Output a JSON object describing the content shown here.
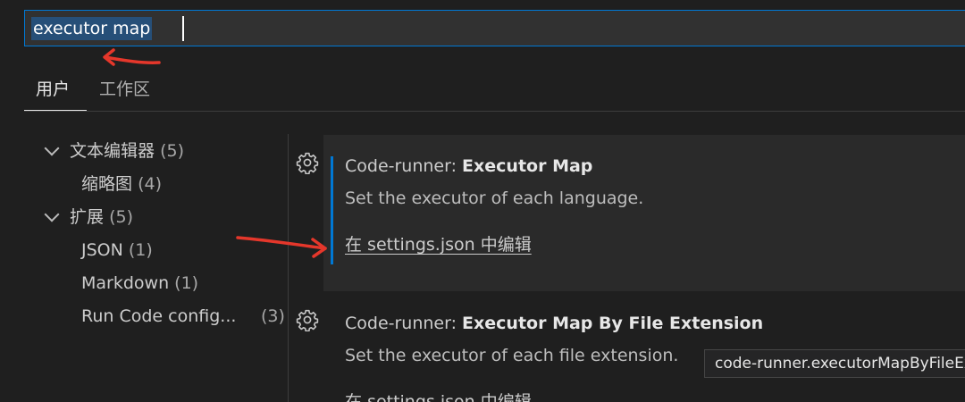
{
  "search": {
    "query": "executor map"
  },
  "tabs": [
    {
      "label": "用户"
    },
    {
      "label": "工作区"
    }
  ],
  "tree": {
    "text_editor": {
      "label": "文本编辑器",
      "count": "(5)"
    },
    "minimap": {
      "label": "缩略图",
      "count": "(4)"
    },
    "extensions": {
      "label": "扩展",
      "count": "(5)"
    },
    "json": {
      "label": "JSON",
      "count": "(1)"
    },
    "markdown": {
      "label": "Markdown",
      "count": "(1)"
    },
    "run_code": {
      "label": "Run Code config...",
      "count": "(3)"
    }
  },
  "settings": [
    {
      "category": "Code-runner: ",
      "name": "Executor Map",
      "description": "Set the executor of each language.",
      "edit_link": "在 settings.json 中编辑"
    },
    {
      "category": "Code-runner: ",
      "name": "Executor Map By File Extension",
      "description": "Set the executor of each file extension.",
      "edit_link": "在 settings.json 中编辑"
    }
  ],
  "tooltip": {
    "text": "code-runner.executorMapByFileExtension"
  },
  "colors": {
    "background": "#1f1f1f",
    "focus_border": "#0078d4",
    "annotation_arrow": "#e5372b"
  }
}
